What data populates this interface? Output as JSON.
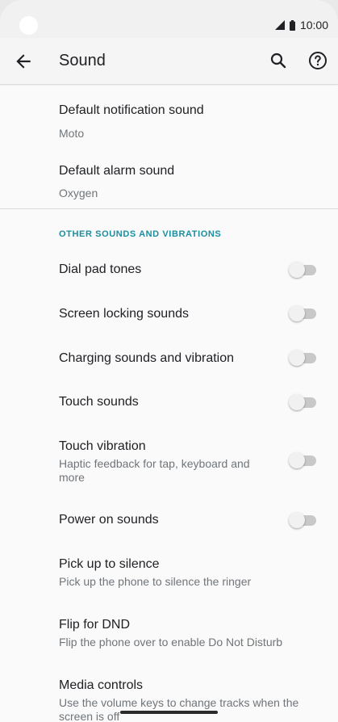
{
  "status_bar": {
    "time": "10:00"
  },
  "app_bar": {
    "title": "Sound"
  },
  "items": [
    {
      "title": "Default notification sound",
      "subtitle": "Moto"
    },
    {
      "title": "Default alarm sound",
      "subtitle": "Oxygen"
    }
  ],
  "section": {
    "header": "OTHER SOUNDS AND VIBRATIONS"
  },
  "toggles": [
    {
      "title": "Dial pad tones",
      "state": "off"
    },
    {
      "title": "Screen locking sounds",
      "state": "off"
    },
    {
      "title": "Charging sounds and vibration",
      "state": "off"
    },
    {
      "title": "Touch sounds",
      "state": "off"
    },
    {
      "title": "Touch vibration",
      "subtitle": "Haptic feedback for tap, keyboard and more",
      "state": "off"
    },
    {
      "title": "Power on sounds",
      "state": "off"
    }
  ],
  "more_items": [
    {
      "title": "Pick up to silence",
      "subtitle": "Pick up the phone to silence the ringer"
    },
    {
      "title": "Flip for DND",
      "subtitle": "Flip the phone over to enable Do Not Disturb"
    },
    {
      "title": "Media controls",
      "subtitle": "Use the volume keys to change tracks when the screen is off"
    }
  ],
  "colors": {
    "accent": "#1a8fa0",
    "background": "#fafafa",
    "toggle_off_track": "#c8c8c8"
  }
}
